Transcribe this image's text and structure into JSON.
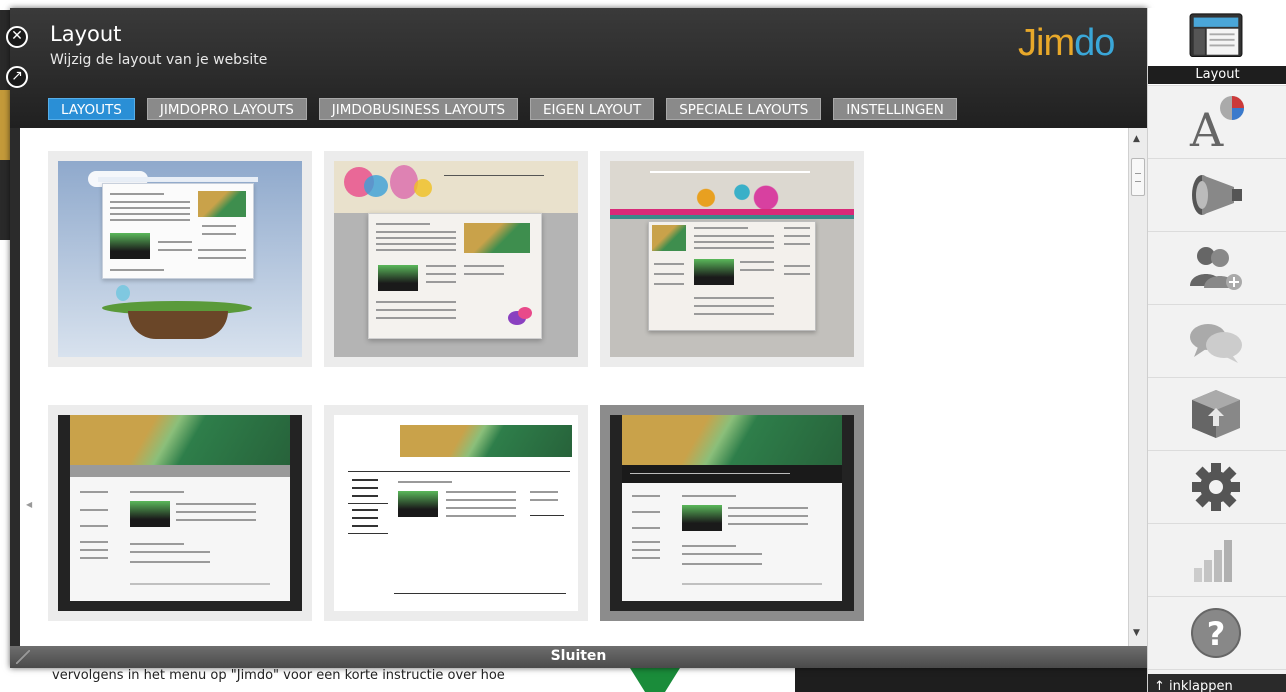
{
  "panel": {
    "title": "Layout",
    "subtitle": "Wijzig de layout van je website",
    "logo": "Jimdo",
    "close_label": "Sluiten"
  },
  "tabs": [
    {
      "label": "LAYOUTS",
      "active": true
    },
    {
      "label": "JIMDOPRO LAYOUTS",
      "active": false
    },
    {
      "label": "JIMDOBUSINESS LAYOUTS",
      "active": false
    },
    {
      "label": "EIGEN LAYOUT",
      "active": false
    },
    {
      "label": "SPECIALE LAYOUTS",
      "active": false
    },
    {
      "label": "INSTELLINGEN",
      "active": false
    }
  ],
  "layouts": [
    {
      "theme": "blue-sky-island",
      "selected": false
    },
    {
      "theme": "colorful-splash",
      "selected": false
    },
    {
      "theme": "pink-swirl",
      "selected": false
    },
    {
      "theme": "beach-dark",
      "selected": false
    },
    {
      "theme": "beach-white",
      "selected": false
    },
    {
      "theme": "beach-dark-nav",
      "selected": true
    }
  ],
  "sidebar": {
    "items": [
      {
        "icon": "layout-icon",
        "label": "Layout",
        "active": true
      },
      {
        "icon": "font-style-icon"
      },
      {
        "icon": "megaphone-icon"
      },
      {
        "icon": "add-user-icon"
      },
      {
        "icon": "chat-bubbles-icon"
      },
      {
        "icon": "package-icon"
      },
      {
        "icon": "gear-icon"
      },
      {
        "icon": "statistics-icon"
      },
      {
        "icon": "help-icon"
      }
    ],
    "collapse_label": "inklappen"
  },
  "background": {
    "text": "vervolgens in het menu op \"Jimdo\" voor een korte instructie over hoe"
  },
  "colors": {
    "accent": "#2a8fd6",
    "logo_orange": "#e8a82a",
    "header": "#2b2b2b"
  }
}
